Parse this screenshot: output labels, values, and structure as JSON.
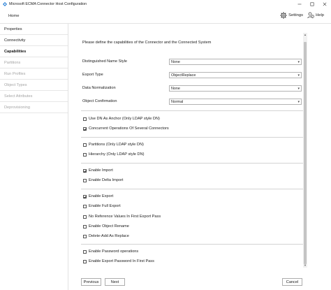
{
  "window": {
    "title": "Microsoft ECMA Connector Host Configuration",
    "accent_color": "#1e7bd6"
  },
  "menu": {
    "home": "Home",
    "settings": "Settings",
    "help": "Help"
  },
  "sidebar": {
    "items": [
      {
        "label": "Properties",
        "state": "enabled"
      },
      {
        "label": "Connectivity",
        "state": "enabled"
      },
      {
        "label": "Capabilities",
        "state": "selected"
      },
      {
        "label": "Partitions",
        "state": "disabled"
      },
      {
        "label": "Run Profiles",
        "state": "disabled"
      },
      {
        "label": "Object Types",
        "state": "disabled"
      },
      {
        "label": "Select Attributes",
        "state": "disabled"
      },
      {
        "label": "Deprovisioning",
        "state": "disabled"
      }
    ]
  },
  "main": {
    "intro": "Please define the capabilities of the Connector and the Connected System",
    "fields": [
      {
        "label": "Distinguished Name Style",
        "value": "None"
      },
      {
        "label": "Export Type",
        "value": "ObjectReplace"
      },
      {
        "label": "Data Normalization",
        "value": "None"
      },
      {
        "label": "Object Confirmation",
        "value": "Normal"
      }
    ],
    "checks": [
      {
        "label": "Use DN As Anchor (Only LDAP style DN)",
        "checked": false
      },
      {
        "label": "Concurrent Operations Of Several Connectors",
        "checked": true
      },
      {
        "label": "Partitions (Only LDAP style DN)",
        "checked": false
      },
      {
        "label": "Hierarchy (Only LDAP style DN)",
        "checked": false
      },
      {
        "label": "Enable Import",
        "checked": true
      },
      {
        "label": "Enable Delta Import",
        "checked": false
      },
      {
        "label": "Enable Export",
        "checked": true
      },
      {
        "label": "Enable Full Export",
        "checked": false
      },
      {
        "label": "No Reference Values In First Export Pass",
        "checked": false
      },
      {
        "label": "Enable Object Rename",
        "checked": false
      },
      {
        "label": "Delete-Add As Replace",
        "checked": false
      },
      {
        "label": "Enable Password operations",
        "checked": false
      },
      {
        "label": "Enable Export Password In First Pass",
        "checked": false
      }
    ]
  },
  "buttons": {
    "previous": "Previous",
    "next": "Next",
    "cancel": "Cancel"
  }
}
